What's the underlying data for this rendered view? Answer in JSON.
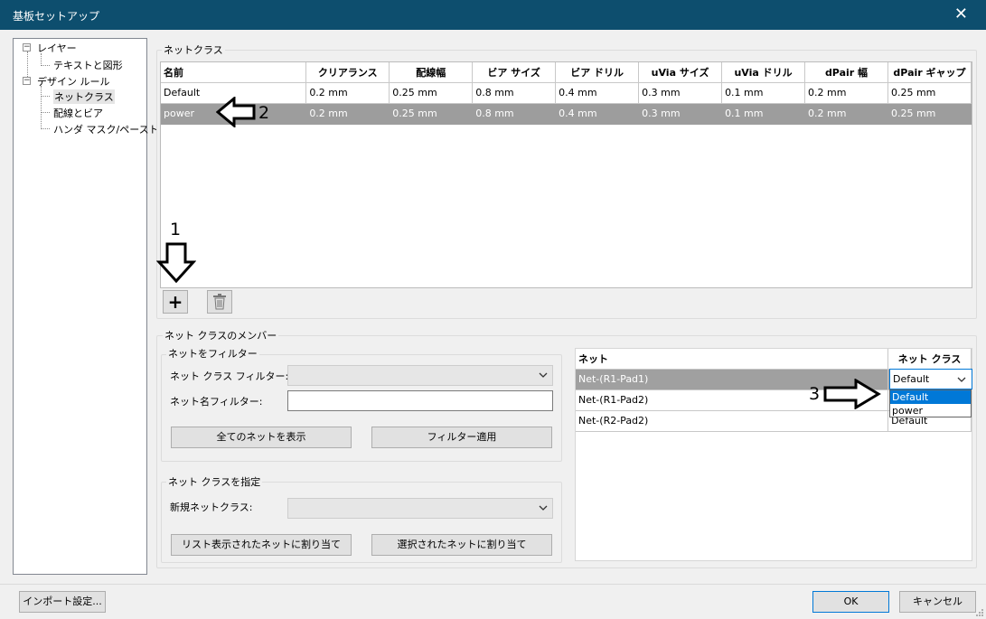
{
  "window": {
    "title": "基板セットアップ",
    "close_glyph": "✕"
  },
  "tree": {
    "items": [
      {
        "label": "レイヤー",
        "toggle": "−"
      },
      {
        "label": "テキストと図形"
      },
      {
        "label": "デザイン ルール",
        "toggle": "−"
      },
      {
        "label": "ネットクラス"
      },
      {
        "label": "配線とビア"
      },
      {
        "label": "ハンダ マスク/ペースト"
      }
    ]
  },
  "netclass": {
    "group_label": "ネットクラス",
    "columns": [
      "名前",
      "クリアランス",
      "配線幅",
      "ビア サイズ",
      "ビア ドリル",
      "uVia サイズ",
      "uVia ドリル",
      "dPair 幅",
      "dPair ギャップ"
    ],
    "rows": [
      [
        "Default",
        "0.2 mm",
        "0.25 mm",
        "0.8 mm",
        "0.4 mm",
        "0.3 mm",
        "0.1 mm",
        "0.2 mm",
        "0.25 mm"
      ],
      [
        "power",
        "0.2 mm",
        "0.25 mm",
        "0.8 mm",
        "0.4 mm",
        "0.3 mm",
        "0.1 mm",
        "0.2 mm",
        "0.25 mm"
      ]
    ],
    "add_glyph": "+"
  },
  "members": {
    "group_label": "ネット クラスのメンバー",
    "filter": {
      "group_label": "ネットをフィルター",
      "netclass_filter_label": "ネット クラス フィルター:",
      "netname_filter_label": "ネット名フィルター:",
      "netname_filter_value": "",
      "show_all_button": "全てのネットを表示",
      "apply_filter_button": "フィルター適用"
    },
    "assign": {
      "group_label": "ネット クラスを指定",
      "new_netclass_label": "新規ネットクラス:",
      "assign_listed_button": "リスト表示されたネットに割り当て",
      "assign_selected_button": "選択されたネットに割り当て"
    },
    "nets": {
      "columns": [
        "ネット",
        "ネット クラス"
      ],
      "rows": [
        [
          "Net-(R1-Pad1)",
          "Default"
        ],
        [
          "Net-(R1-Pad2)",
          ""
        ],
        [
          "Net-(R2-Pad2)",
          "Default"
        ]
      ],
      "dropdown_value": "Default",
      "dropdown_options": [
        "Default",
        "power"
      ]
    }
  },
  "annotations": [
    "1",
    "2",
    "3"
  ],
  "footer": {
    "import_button": "インポート設定...",
    "ok_button": "OK",
    "cancel_button": "キャンセル"
  }
}
